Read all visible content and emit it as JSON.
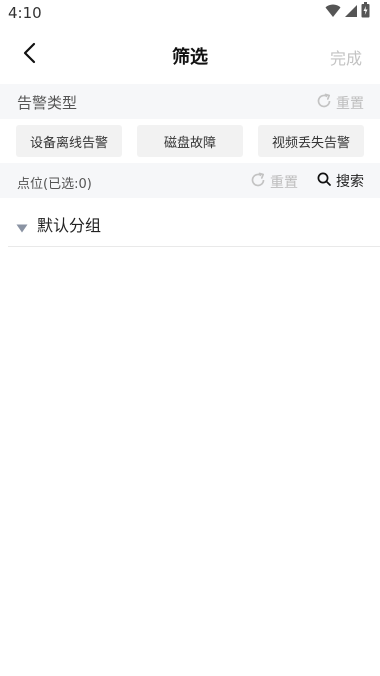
{
  "status_bar": {
    "time": "4:10"
  },
  "nav": {
    "title": "筛选",
    "done_label": "完成"
  },
  "alarm_type": {
    "title": "告警类型",
    "reset_label": "重置",
    "options": [
      "设备离线告警",
      "磁盘故障",
      "视频丢失告警"
    ]
  },
  "points": {
    "title": "点位",
    "selected_text": "(已选:0)",
    "reset_label": "重置",
    "search_label": "搜索"
  },
  "groups": [
    {
      "label": "默认分组"
    }
  ]
}
